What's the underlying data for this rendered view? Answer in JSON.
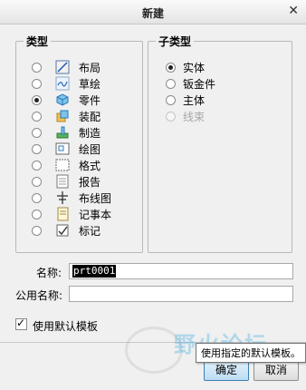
{
  "dialog": {
    "title": "新建",
    "close_icon": "close-icon"
  },
  "type_group": {
    "title": "类型",
    "items": [
      {
        "label": "布局",
        "icon": "layout-icon",
        "selected": false
      },
      {
        "label": "草绘",
        "icon": "sketch-icon",
        "selected": false
      },
      {
        "label": "零件",
        "icon": "part-icon",
        "selected": true
      },
      {
        "label": "装配",
        "icon": "assembly-icon",
        "selected": false
      },
      {
        "label": "制造",
        "icon": "manufacturing-icon",
        "selected": false
      },
      {
        "label": "绘图",
        "icon": "drawing-icon",
        "selected": false
      },
      {
        "label": "格式",
        "icon": "format-icon",
        "selected": false
      },
      {
        "label": "报告",
        "icon": "report-icon",
        "selected": false
      },
      {
        "label": "布线图",
        "icon": "diagram-icon",
        "selected": false
      },
      {
        "label": "记事本",
        "icon": "notebook-icon",
        "selected": false
      },
      {
        "label": "标记",
        "icon": "markup-icon",
        "selected": false
      }
    ]
  },
  "subtype_group": {
    "title": "子类型",
    "items": [
      {
        "label": "实体",
        "selected": true,
        "disabled": false
      },
      {
        "label": "钣金件",
        "selected": false,
        "disabled": false
      },
      {
        "label": "主体",
        "selected": false,
        "disabled": false
      },
      {
        "label": "线束",
        "selected": false,
        "disabled": true
      }
    ]
  },
  "name": {
    "label": "名称:",
    "value": "prt0001"
  },
  "common_name": {
    "label": "公用名称:",
    "value": ""
  },
  "use_default_template": {
    "label": "使用默认模板",
    "checked": true
  },
  "buttons": {
    "ok": "确定",
    "cancel": "取消"
  },
  "tooltip": "使用指定的默认模板。",
  "watermark": "野火论坛",
  "colors": {
    "primary_button": "#bcdcf2",
    "watermark": "#3caadc"
  }
}
